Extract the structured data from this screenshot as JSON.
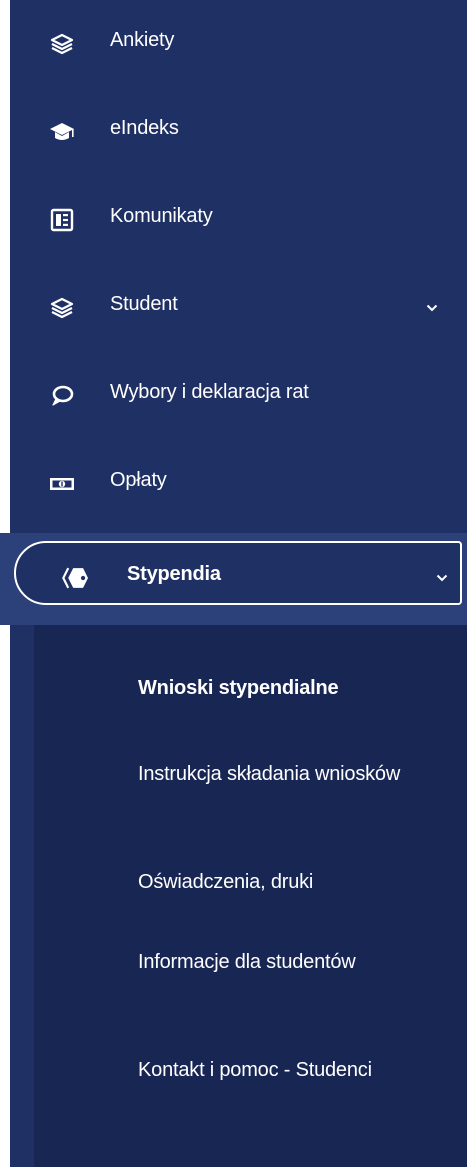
{
  "menu": {
    "items": [
      {
        "label": "Ankiety",
        "icon": "layers-icon"
      },
      {
        "label": "eIndeks",
        "icon": "graduation-cap-icon"
      },
      {
        "label": "Komunikaty",
        "icon": "newspaper-icon"
      },
      {
        "label": "Student",
        "icon": "layers-icon",
        "has_submenu": true
      },
      {
        "label": "Wybory i deklaracja rat",
        "icon": "speech-bubble-icon"
      },
      {
        "label": "Opłaty",
        "icon": "money-bill-icon"
      },
      {
        "label": "Stypendia",
        "icon": "tags-icon",
        "has_submenu": true,
        "active": true,
        "expanded": true
      }
    ],
    "submenu": [
      {
        "label": "Wnioski stypendialne",
        "active": true
      },
      {
        "label": "Instrukcja składania wniosków"
      },
      {
        "label": "Oświadczenia, druki"
      },
      {
        "label": "Informacje dla studentów"
      },
      {
        "label": "Kontakt i pomoc - Studenci"
      }
    ]
  },
  "colors": {
    "sidebar_bg": "#1f3064",
    "active_band": "#2c4079",
    "submenu_bg": "#182654",
    "text": "#ffffff"
  }
}
